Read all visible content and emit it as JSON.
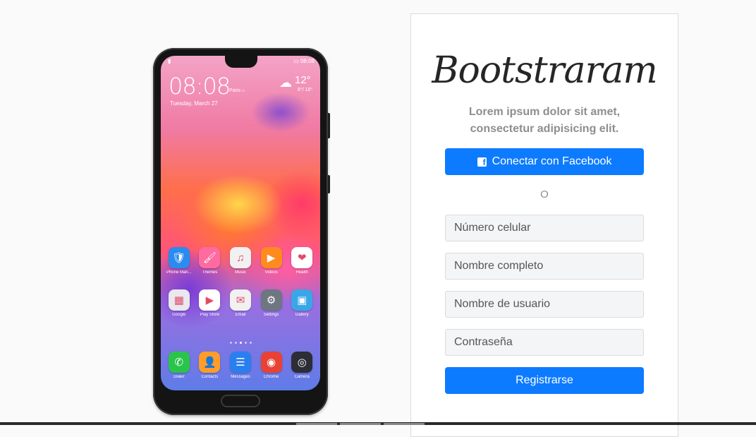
{
  "phone": {
    "status_right": "08:08",
    "clock": "08:08",
    "city": "Paris ⌂",
    "date": "Tuesday, March 27",
    "temperature": "12°",
    "temperature_range": "8°/ 18°",
    "apps_row1": [
      {
        "label": "Phone Man...",
        "glyph": "🛡",
        "bg": "#2a8cf0"
      },
      {
        "label": "Themes",
        "glyph": "🖌",
        "bg": "#ff6aa0"
      },
      {
        "label": "Music",
        "glyph": "♫",
        "bg": "#f1f1f1"
      },
      {
        "label": "Videos",
        "glyph": "▶",
        "bg": "#ff8a1f"
      },
      {
        "label": "Health",
        "glyph": "❤",
        "bg": "#ffffff"
      }
    ],
    "apps_row2": [
      {
        "label": "Google",
        "glyph": "▦",
        "bg": "#e8e8ee"
      },
      {
        "label": "Play Store",
        "glyph": "▶",
        "bg": "#ffffff"
      },
      {
        "label": "Email",
        "glyph": "✉",
        "bg": "#f1f1f1"
      },
      {
        "label": "Settings",
        "glyph": "⚙",
        "bg": "#6e7781"
      },
      {
        "label": "Gallery",
        "glyph": "▣",
        "bg": "#3aa6e8"
      }
    ],
    "dock": [
      {
        "label": "Dialer",
        "glyph": "✆",
        "bg": "#2bc44b"
      },
      {
        "label": "Contacts",
        "glyph": "👤",
        "bg": "#ff9d2a"
      },
      {
        "label": "Messages",
        "glyph": "☰",
        "bg": "#2a7ff0"
      },
      {
        "label": "Chrome",
        "glyph": "◉",
        "bg": "#e94235"
      },
      {
        "label": "Camera",
        "glyph": "◎",
        "bg": "#2d2d35"
      }
    ]
  },
  "signup": {
    "logo": "Bootstraram",
    "tagline": "Lorem ipsum dolor sit amet, consectetur adipisicing elit.",
    "facebook_button": "Conectar con Facebook",
    "facebook_icon": "f",
    "divider": "O",
    "fields": {
      "phone_placeholder": "Número celular",
      "fullname_placeholder": "Nombre completo",
      "username_placeholder": "Nombre de usuario",
      "password_placeholder": "Contraseña"
    },
    "register_button": "Registrarse"
  },
  "colors": {
    "primary": "#0d7bff",
    "card_border": "#dbdbdb",
    "muted_text": "#8e8e8e"
  }
}
